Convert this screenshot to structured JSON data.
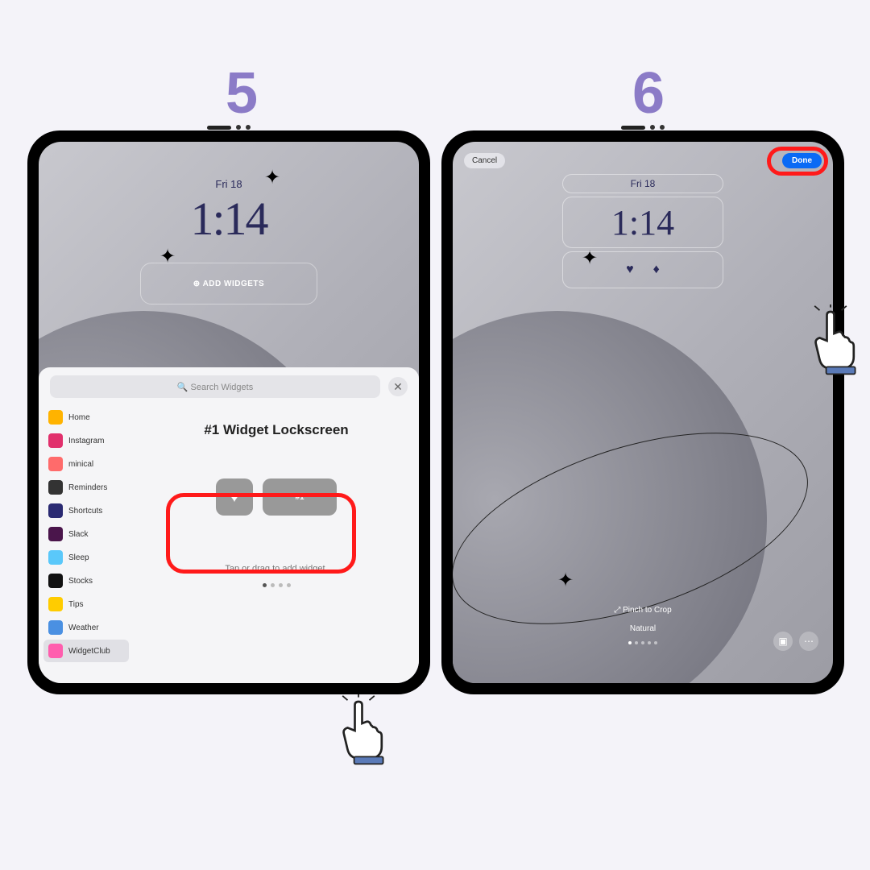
{
  "steps": {
    "five": "5",
    "six": "6"
  },
  "lock": {
    "date": "Fri 18",
    "time": "1:14",
    "add_widgets": "⊕ ADD WIDGETS"
  },
  "sheet": {
    "search_placeholder": "🔍 Search Widgets",
    "apps": [
      "Home",
      "Instagram",
      "minical",
      "Reminders",
      "Shortcuts",
      "Slack",
      "Sleep",
      "Stocks",
      "Tips",
      "Weather",
      "WidgetClub"
    ],
    "detail_title": "#1 Widget Lockscreen",
    "widget_lg_label": "#1",
    "hint": "Tap or drag to add widget."
  },
  "edit": {
    "cancel": "Cancel",
    "done": "Done",
    "pinch": "⤢ Pinch to Crop",
    "filter": "Natural"
  },
  "app_colors": [
    "#ffb300",
    "#e1306c",
    "#ff6b6b",
    "#333",
    "#2a2a72",
    "#4a154b",
    "#5ac8fa",
    "#111",
    "#ffcc00",
    "#4a90e2",
    "#ff5eae"
  ]
}
